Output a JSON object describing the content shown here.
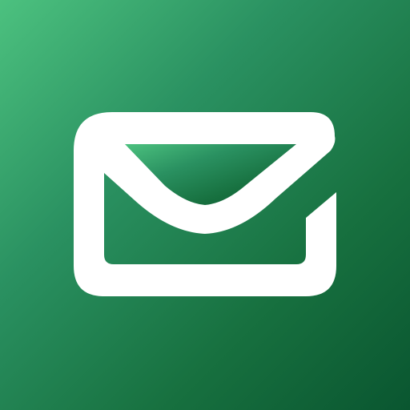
{
  "icon": {
    "name": "mail-envelope-icon",
    "colors": {
      "gradient_start": "#4cc17f",
      "gradient_end": "#0b5c33",
      "glyph": "#ffffff"
    }
  }
}
